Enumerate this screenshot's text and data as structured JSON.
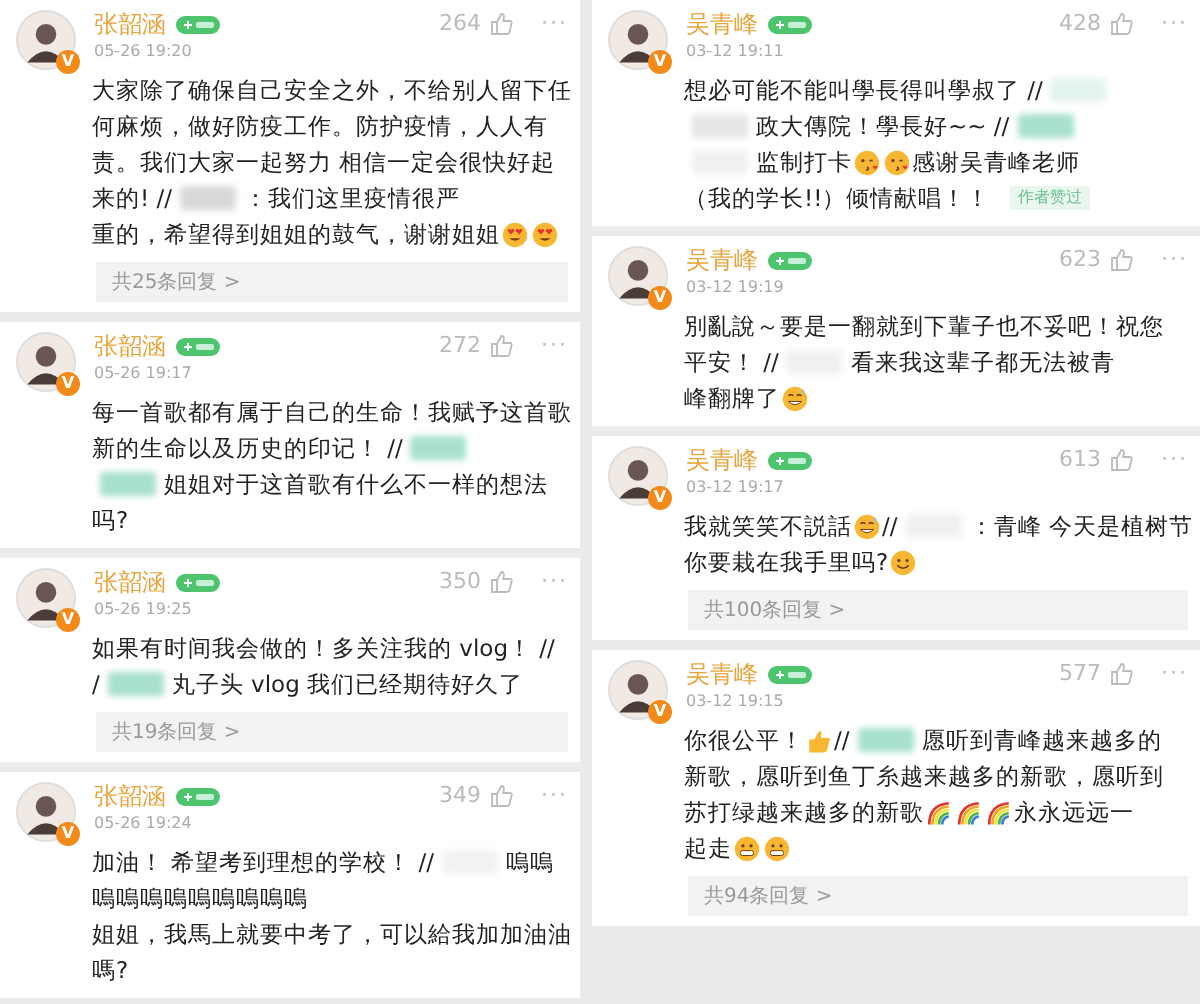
{
  "columns": [
    {
      "comments": [
        {
          "name": "张韶涵",
          "verified_mark": "V",
          "time": "05-26 19:20",
          "likes": "264",
          "more": "···",
          "body": [
            [
              {
                "kind": "text",
                "text": "大家除了确保自己安全之外，不给别人留下任"
              }
            ],
            [
              {
                "kind": "text",
                "text": "何麻烦，做好防疫工作。防护疫情，人人有"
              }
            ],
            [
              {
                "kind": "text",
                "text": "责。我们大家一起努力 相信一定会很快好起"
              }
            ],
            [
              {
                "kind": "text",
                "text": "来的! //"
              },
              {
                "kind": "blur",
                "color": "#d9d9d9"
              },
              {
                "kind": "text",
                "text": "：我们这里疫情很严"
              }
            ],
            [
              {
                "kind": "text",
                "text": "重的，希望得到姐姐的鼓气，谢谢姐姐"
              },
              {
                "kind": "heart_eyes"
              },
              {
                "kind": "heart_eyes"
              }
            ]
          ],
          "replies": "共25条回复 >"
        },
        {
          "name": "张韶涵",
          "verified_mark": "V",
          "time": "05-26 19:17",
          "likes": "272",
          "more": "···",
          "body": [
            [
              {
                "kind": "text",
                "text": "每一首歌都有属于自己的生命！我赋予这首歌"
              }
            ],
            [
              {
                "kind": "text",
                "text": "新的生命以及历史的印记！ //"
              },
              {
                "kind": "blur",
                "color": "#a8e0cc"
              }
            ],
            [
              {
                "kind": "blur",
                "color": "#a8e0cc"
              },
              {
                "kind": "text",
                "text": "姐姐对于这首歌有什么不一样的想法"
              }
            ],
            [
              {
                "kind": "text",
                "text": "吗?"
              }
            ]
          ]
        },
        {
          "name": "张韶涵",
          "verified_mark": "V",
          "time": "05-26 19:25",
          "likes": "350",
          "more": "···",
          "body": [
            [
              {
                "kind": "text",
                "text": "如果有时间我会做的！多关注我的 vlog！ //"
              }
            ],
            [
              {
                "kind": "text",
                "text": "/"
              },
              {
                "kind": "blur",
                "color": "#a8e0cc"
              },
              {
                "kind": "text",
                "text": "丸子头 vlog 我们已经期待好久了"
              }
            ]
          ],
          "replies": "共19条回复 >"
        },
        {
          "name": "张韶涵",
          "verified_mark": "V",
          "time": "05-26 19:24",
          "likes": "349",
          "more": "···",
          "body": [
            [
              {
                "kind": "text",
                "text": "加油！ 希望考到理想的学校！ //"
              },
              {
                "kind": "blur",
                "color": "#f2f2f2"
              },
              {
                "kind": "text",
                "text": "嗚嗚"
              }
            ],
            [
              {
                "kind": "text",
                "text": "嗚嗚嗚嗚嗚嗚嗚嗚嗚"
              }
            ],
            [
              {
                "kind": "text",
                "text": "姐姐，我馬上就要中考了，可以給我加加油油"
              }
            ],
            [
              {
                "kind": "text",
                "text": "嗎?"
              }
            ]
          ]
        }
      ]
    },
    {
      "comments": [
        {
          "name": "吴青峰",
          "verified_mark": "V",
          "time": "03-12 19:11",
          "likes": "428",
          "more": "···",
          "body": [
            [
              {
                "kind": "text",
                "text": "想必可能不能叫學長得叫學叔了 //"
              },
              {
                "kind": "blur",
                "color": "#e3f3ee"
              }
            ],
            [
              {
                "kind": "blur",
                "color": "#e6e6e6"
              },
              {
                "kind": "text",
                "text": "政大傳院！學長好~~ //"
              },
              {
                "kind": "blur",
                "color": "#a8e0cc"
              }
            ],
            [
              {
                "kind": "blur",
                "color": "#f0f0f0"
              },
              {
                "kind": "text",
                "text": "监制打卡"
              },
              {
                "kind": "kiss"
              },
              {
                "kind": "kiss"
              },
              {
                "kind": "text",
                "text": "感谢吴青峰老师"
              }
            ],
            [
              {
                "kind": "text",
                "text": "（我的学长!!）倾情献唱！！"
              },
              {
                "kind": "tag",
                "text": "作者赞过"
              }
            ]
          ]
        },
        {
          "name": "吴青峰",
          "verified_mark": "V",
          "time": "03-12 19:19",
          "likes": "623",
          "more": "···",
          "body": [
            [
              {
                "kind": "text",
                "text": "別亂說～要是一翻就到下輩子也不妥吧！祝您"
              }
            ],
            [
              {
                "kind": "text",
                "text": "平安！ //"
              },
              {
                "kind": "blur",
                "color": "#f0f0f0"
              },
              {
                "kind": "text",
                "text": "看来我这辈子都无法被青"
              }
            ],
            [
              {
                "kind": "text",
                "text": "峰翻牌了"
              },
              {
                "kind": "grin_sweat"
              }
            ]
          ]
        },
        {
          "name": "吴青峰",
          "verified_mark": "V",
          "time": "03-12 19:17",
          "likes": "613",
          "more": "···",
          "body": [
            [
              {
                "kind": "text",
                "text": "我就笑笑不説話"
              },
              {
                "kind": "grin_sweat"
              },
              {
                "kind": "text",
                "text": "//"
              },
              {
                "kind": "blur",
                "color": "#f0f0f0"
              },
              {
                "kind": "text",
                "text": "：青峰 今天是植树节"
              }
            ],
            [
              {
                "kind": "text",
                "text": "你要栽在我手里吗?"
              },
              {
                "kind": "smile"
              }
            ]
          ],
          "replies": "共100条回复 >"
        },
        {
          "name": "吴青峰",
          "verified_mark": "V",
          "time": "03-12 19:15",
          "likes": "577",
          "more": "···",
          "body": [
            [
              {
                "kind": "text",
                "text": "你很公平！"
              },
              {
                "kind": "thumbs_up"
              },
              {
                "kind": "text",
                "text": "//"
              },
              {
                "kind": "blur",
                "color": "#a8e0cc"
              },
              {
                "kind": "text",
                "text": "愿听到青峰越来越多的"
              }
            ],
            [
              {
                "kind": "text",
                "text": "新歌，愿听到鱼丁糸越来越多的新歌，愿听到"
              }
            ],
            [
              {
                "kind": "text",
                "text": "苏打绿越来越多的新歌"
              },
              {
                "kind": "rainbow"
              },
              {
                "kind": "rainbow"
              },
              {
                "kind": "rainbow"
              },
              {
                "kind": "text",
                "text": "永永远远一"
              }
            ],
            [
              {
                "kind": "text",
                "text": "起走"
              },
              {
                "kind": "grimace"
              },
              {
                "kind": "grimace"
              }
            ]
          ],
          "replies": "共94条回复 >"
        }
      ]
    }
  ]
}
